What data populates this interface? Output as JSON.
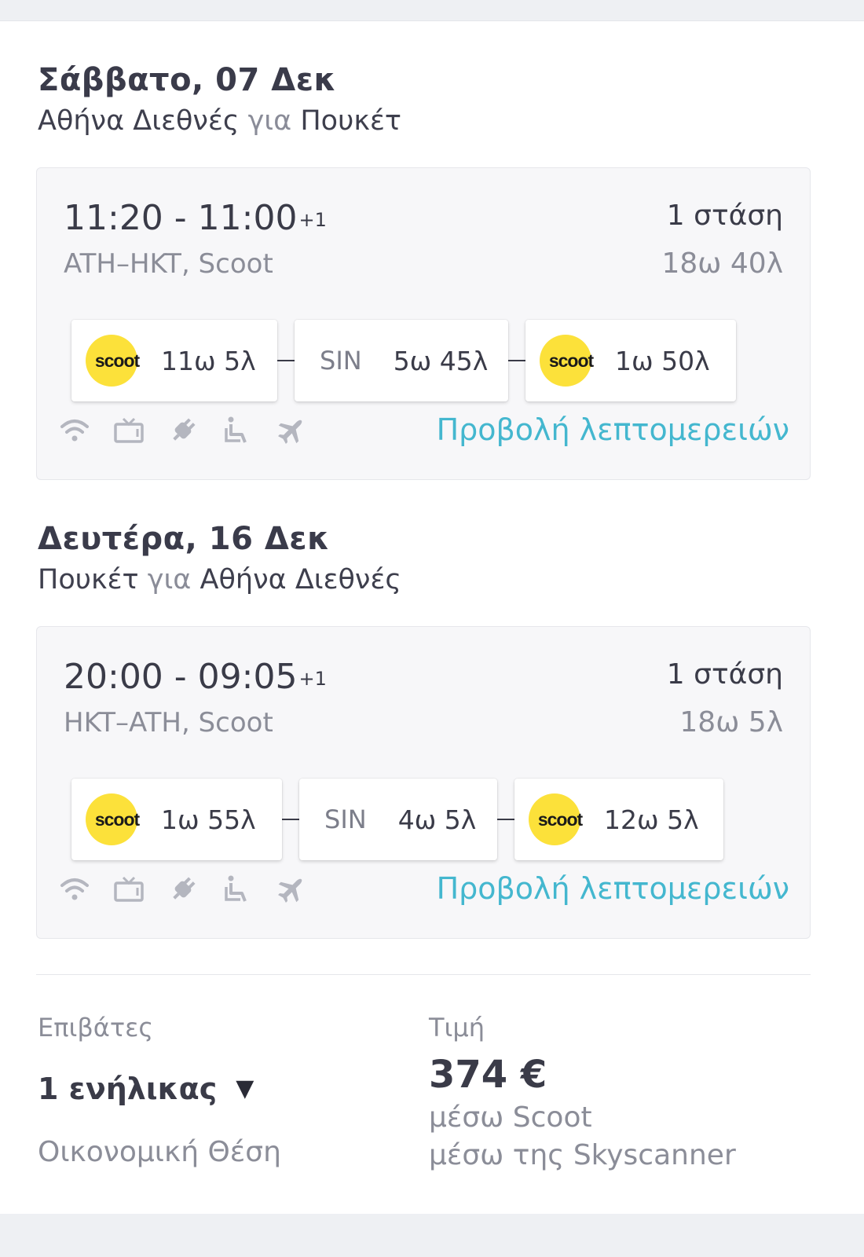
{
  "outbound": {
    "date": "Σάββατο, 07 Δεκ",
    "origin": "Αθήνα Διεθνές",
    "connector": "για",
    "destination": "Πουκέτ",
    "times": "11:20 - 11:00",
    "day_offset": "+1",
    "codes": "ATH–HKT, Scoot",
    "stops": "1 στάση",
    "duration": "18ω 40λ",
    "legs": [
      {
        "logo": "scoot",
        "duration": "11ω 5λ"
      },
      {
        "code": "SIN",
        "layover": "5ω 45λ"
      },
      {
        "logo": "scoot",
        "duration": "1ω 50λ"
      }
    ],
    "details_link": "Προβολή λεπτομερειών"
  },
  "inbound": {
    "date": "Δευτέρα, 16 Δεκ",
    "origin": "Πουκέτ",
    "connector": "για",
    "destination": "Αθήνα Διεθνές",
    "times": "20:00 - 09:05",
    "day_offset": "+1",
    "codes": "HKT–ATH, Scoot",
    "stops": "1 στάση",
    "duration": "18ω 5λ",
    "legs": [
      {
        "logo": "scoot",
        "duration": "1ω 55λ"
      },
      {
        "code": "SIN",
        "layover": "4ω 5λ"
      },
      {
        "logo": "scoot",
        "duration": "12ω 5λ"
      }
    ],
    "details_link": "Προβολή λεπτομερειών"
  },
  "amenity_icons": [
    "wifi-icon",
    "tv-icon",
    "power-plug-icon",
    "wheelchair-icon",
    "airplane-icon"
  ],
  "booking": {
    "passengers_label": "Επιβάτες",
    "passengers_value": "1 ενήλικας",
    "cabin_class": "Οικονομική Θέση",
    "price_label": "Τιμή",
    "price": "374 €",
    "via_airline": "μέσω Scoot",
    "via_site": "μέσω της Skyscanner"
  },
  "colors": {
    "accent_link": "#44b7cf",
    "scoot_yellow": "#fce13a",
    "text_primary": "#3a3b48",
    "text_muted": "#8b8d98",
    "card_bg": "#f7f7f9"
  }
}
